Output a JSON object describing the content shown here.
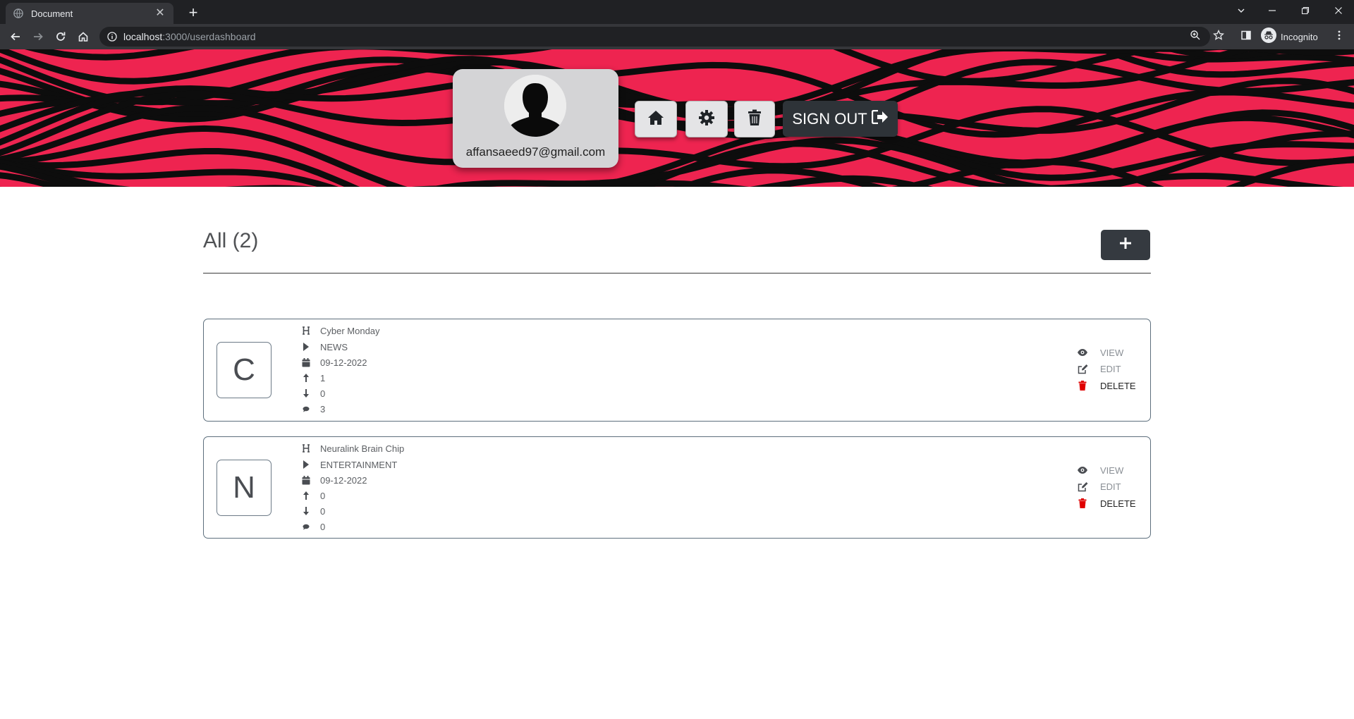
{
  "browser": {
    "tab_title": "Document",
    "tab_close": "✕",
    "new_tab": "+",
    "url_host": "localhost",
    "url_rest": ":3000/userdashboard",
    "profile_label": "Incognito",
    "window_controls": [
      "chevron-down-icon",
      "minimize-icon",
      "restore-icon",
      "close-icon"
    ]
  },
  "banner": {
    "email": "affansaeed97@gmail.com",
    "signout_label": "SIGN OUT",
    "colors": {
      "background": "#ee2450",
      "stripes": "#0d0d0d"
    }
  },
  "section": {
    "title": "All (2)"
  },
  "posts": [
    {
      "letter": "C",
      "title": "Cyber Monday",
      "category": "NEWS",
      "date": "09-12-2022",
      "upvotes": "1",
      "downvotes": "0",
      "comments": "3"
    },
    {
      "letter": "N",
      "title": "Neuralink Brain Chip",
      "category": "ENTERTAINMENT",
      "date": "09-12-2022",
      "upvotes": "0",
      "downvotes": "0",
      "comments": "0"
    }
  ],
  "actions": {
    "view": "VIEW",
    "edit": "EDIT",
    "delete": "DELETE"
  },
  "colors": {
    "delete_icon": "#e00000",
    "add_button": "#353a40"
  }
}
